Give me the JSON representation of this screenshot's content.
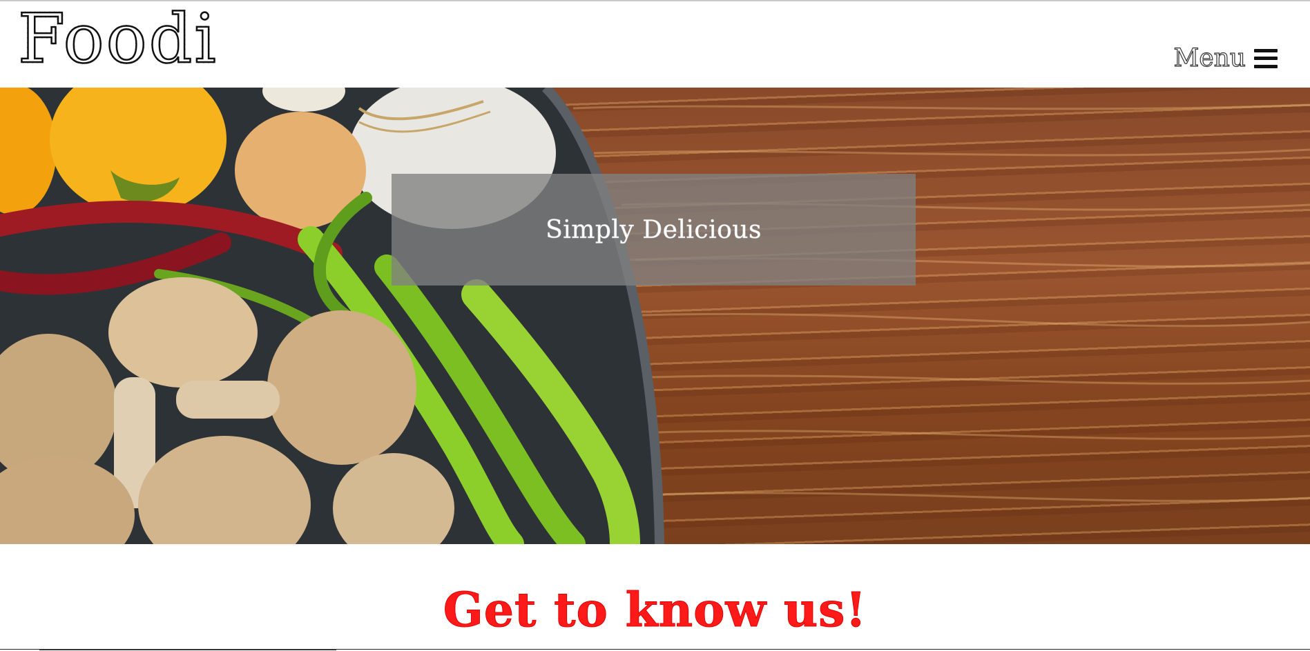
{
  "header": {
    "logo": "Foodi",
    "menu_label": "Menu"
  },
  "hero": {
    "title": "Simply Delicious"
  },
  "intro": {
    "heading": "Get to know us!"
  },
  "icons": {
    "menu": "hamburger-menu-icon"
  },
  "colors": {
    "heading_red": "#ff1a1a",
    "overlay_gray": "#808080"
  }
}
